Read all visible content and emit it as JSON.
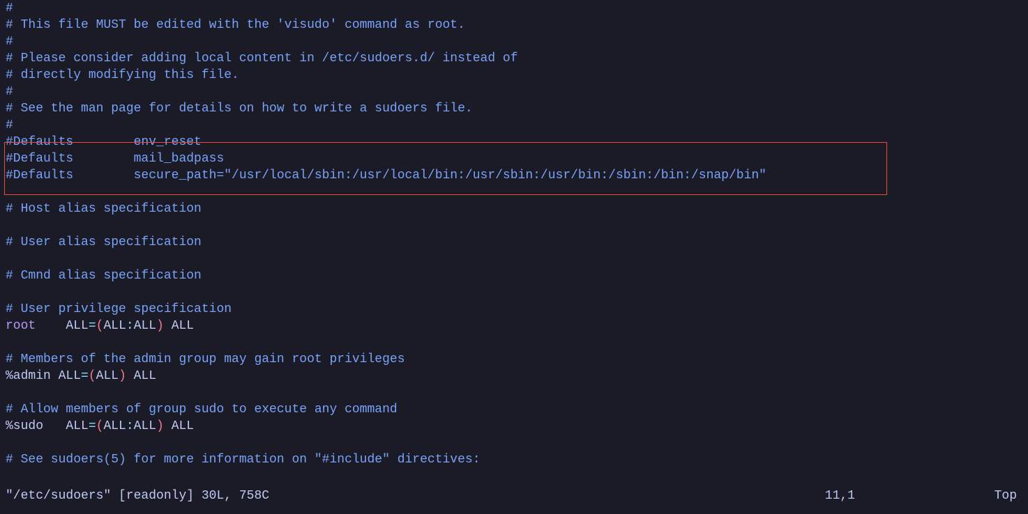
{
  "lines": [
    {
      "segments": [
        {
          "cls": "comment",
          "t": "#"
        }
      ]
    },
    {
      "segments": [
        {
          "cls": "comment",
          "t": "# This file MUST be edited with the 'visudo' command as root."
        }
      ]
    },
    {
      "segments": [
        {
          "cls": "comment",
          "t": "#"
        }
      ]
    },
    {
      "segments": [
        {
          "cls": "comment",
          "t": "# Please consider adding local content in /etc/sudoers.d/ instead of"
        }
      ]
    },
    {
      "segments": [
        {
          "cls": "comment",
          "t": "# directly modifying this file."
        }
      ]
    },
    {
      "segments": [
        {
          "cls": "comment",
          "t": "#"
        }
      ]
    },
    {
      "segments": [
        {
          "cls": "comment",
          "t": "# See the man page for details on how to write a sudoers file."
        }
      ]
    },
    {
      "segments": [
        {
          "cls": "comment",
          "t": "#"
        }
      ]
    },
    {
      "segments": [
        {
          "cls": "comment",
          "t": "#Defaults        env_reset"
        }
      ]
    },
    {
      "segments": [
        {
          "cls": "comment",
          "t": "#Defaults        mail_badpass"
        }
      ]
    },
    {
      "segments": [
        {
          "cls": "comment",
          "t": "#Defaults        secure_path=\"/usr/local/sbin:/usr/local/bin:/usr/sbin:/usr/bin:/sbin:/bin:/snap/bin\""
        }
      ]
    },
    {
      "segments": []
    },
    {
      "segments": [
        {
          "cls": "comment",
          "t": "# Host alias specification"
        }
      ]
    },
    {
      "segments": []
    },
    {
      "segments": [
        {
          "cls": "comment",
          "t": "# User alias specification"
        }
      ]
    },
    {
      "segments": []
    },
    {
      "segments": [
        {
          "cls": "comment",
          "t": "# Cmnd alias specification"
        }
      ]
    },
    {
      "segments": []
    },
    {
      "segments": [
        {
          "cls": "comment",
          "t": "# User privilege specification"
        }
      ]
    },
    {
      "segments": [
        {
          "cls": "keyword",
          "t": "root"
        },
        {
          "cls": "text",
          "t": "    ALL"
        },
        {
          "cls": "operator",
          "t": "="
        },
        {
          "cls": "paren",
          "t": "("
        },
        {
          "cls": "text",
          "t": "ALL"
        },
        {
          "cls": "operator",
          "t": ":"
        },
        {
          "cls": "text",
          "t": "ALL"
        },
        {
          "cls": "paren",
          "t": ")"
        },
        {
          "cls": "text",
          "t": " ALL"
        }
      ]
    },
    {
      "segments": []
    },
    {
      "segments": [
        {
          "cls": "comment",
          "t": "# Members of the admin group may gain root privileges"
        }
      ]
    },
    {
      "segments": [
        {
          "cls": "text",
          "t": "%admin ALL"
        },
        {
          "cls": "operator",
          "t": "="
        },
        {
          "cls": "paren",
          "t": "("
        },
        {
          "cls": "text",
          "t": "ALL"
        },
        {
          "cls": "paren",
          "t": ")"
        },
        {
          "cls": "text",
          "t": " ALL"
        }
      ]
    },
    {
      "segments": []
    },
    {
      "segments": [
        {
          "cls": "comment",
          "t": "# Allow members of group sudo to execute any command"
        }
      ]
    },
    {
      "segments": [
        {
          "cls": "text",
          "t": "%sudo   ALL"
        },
        {
          "cls": "operator",
          "t": "="
        },
        {
          "cls": "paren",
          "t": "("
        },
        {
          "cls": "text",
          "t": "ALL"
        },
        {
          "cls": "operator",
          "t": ":"
        },
        {
          "cls": "text",
          "t": "ALL"
        },
        {
          "cls": "paren",
          "t": ")"
        },
        {
          "cls": "text",
          "t": " ALL"
        }
      ]
    },
    {
      "segments": []
    },
    {
      "segments": [
        {
          "cls": "comment",
          "t": "# See sudoers(5) for more information on \"#include\" directives:"
        }
      ]
    }
  ],
  "status": {
    "file": "\"/etc/sudoers\" [readonly] 30L, 758C",
    "position": "11,1",
    "scroll": "Top"
  }
}
